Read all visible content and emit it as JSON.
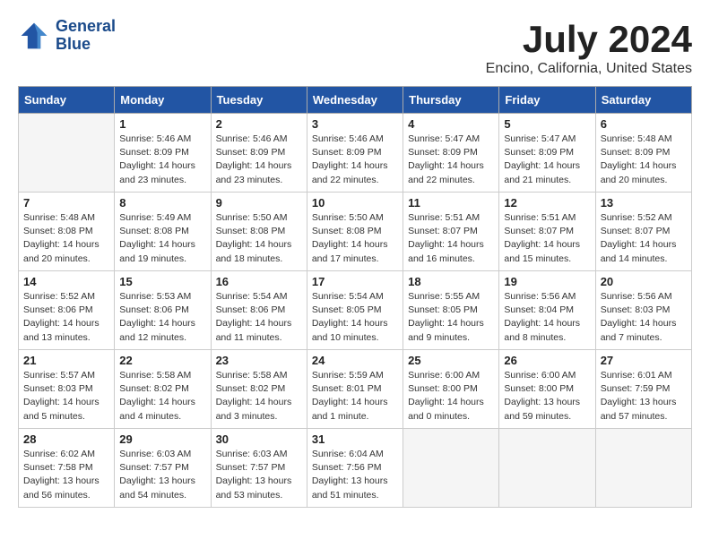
{
  "header": {
    "logo_line1": "General",
    "logo_line2": "Blue",
    "month_title": "July 2024",
    "location": "Encino, California, United States"
  },
  "weekdays": [
    "Sunday",
    "Monday",
    "Tuesday",
    "Wednesday",
    "Thursday",
    "Friday",
    "Saturday"
  ],
  "weeks": [
    [
      {
        "day": "",
        "info": ""
      },
      {
        "day": "1",
        "info": "Sunrise: 5:46 AM\nSunset: 8:09 PM\nDaylight: 14 hours\nand 23 minutes."
      },
      {
        "day": "2",
        "info": "Sunrise: 5:46 AM\nSunset: 8:09 PM\nDaylight: 14 hours\nand 23 minutes."
      },
      {
        "day": "3",
        "info": "Sunrise: 5:46 AM\nSunset: 8:09 PM\nDaylight: 14 hours\nand 22 minutes."
      },
      {
        "day": "4",
        "info": "Sunrise: 5:47 AM\nSunset: 8:09 PM\nDaylight: 14 hours\nand 22 minutes."
      },
      {
        "day": "5",
        "info": "Sunrise: 5:47 AM\nSunset: 8:09 PM\nDaylight: 14 hours\nand 21 minutes."
      },
      {
        "day": "6",
        "info": "Sunrise: 5:48 AM\nSunset: 8:09 PM\nDaylight: 14 hours\nand 20 minutes."
      }
    ],
    [
      {
        "day": "7",
        "info": "Sunrise: 5:48 AM\nSunset: 8:08 PM\nDaylight: 14 hours\nand 20 minutes."
      },
      {
        "day": "8",
        "info": "Sunrise: 5:49 AM\nSunset: 8:08 PM\nDaylight: 14 hours\nand 19 minutes."
      },
      {
        "day": "9",
        "info": "Sunrise: 5:50 AM\nSunset: 8:08 PM\nDaylight: 14 hours\nand 18 minutes."
      },
      {
        "day": "10",
        "info": "Sunrise: 5:50 AM\nSunset: 8:08 PM\nDaylight: 14 hours\nand 17 minutes."
      },
      {
        "day": "11",
        "info": "Sunrise: 5:51 AM\nSunset: 8:07 PM\nDaylight: 14 hours\nand 16 minutes."
      },
      {
        "day": "12",
        "info": "Sunrise: 5:51 AM\nSunset: 8:07 PM\nDaylight: 14 hours\nand 15 minutes."
      },
      {
        "day": "13",
        "info": "Sunrise: 5:52 AM\nSunset: 8:07 PM\nDaylight: 14 hours\nand 14 minutes."
      }
    ],
    [
      {
        "day": "14",
        "info": "Sunrise: 5:52 AM\nSunset: 8:06 PM\nDaylight: 14 hours\nand 13 minutes."
      },
      {
        "day": "15",
        "info": "Sunrise: 5:53 AM\nSunset: 8:06 PM\nDaylight: 14 hours\nand 12 minutes."
      },
      {
        "day": "16",
        "info": "Sunrise: 5:54 AM\nSunset: 8:06 PM\nDaylight: 14 hours\nand 11 minutes."
      },
      {
        "day": "17",
        "info": "Sunrise: 5:54 AM\nSunset: 8:05 PM\nDaylight: 14 hours\nand 10 minutes."
      },
      {
        "day": "18",
        "info": "Sunrise: 5:55 AM\nSunset: 8:05 PM\nDaylight: 14 hours\nand 9 minutes."
      },
      {
        "day": "19",
        "info": "Sunrise: 5:56 AM\nSunset: 8:04 PM\nDaylight: 14 hours\nand 8 minutes."
      },
      {
        "day": "20",
        "info": "Sunrise: 5:56 AM\nSunset: 8:03 PM\nDaylight: 14 hours\nand 7 minutes."
      }
    ],
    [
      {
        "day": "21",
        "info": "Sunrise: 5:57 AM\nSunset: 8:03 PM\nDaylight: 14 hours\nand 5 minutes."
      },
      {
        "day": "22",
        "info": "Sunrise: 5:58 AM\nSunset: 8:02 PM\nDaylight: 14 hours\nand 4 minutes."
      },
      {
        "day": "23",
        "info": "Sunrise: 5:58 AM\nSunset: 8:02 PM\nDaylight: 14 hours\nand 3 minutes."
      },
      {
        "day": "24",
        "info": "Sunrise: 5:59 AM\nSunset: 8:01 PM\nDaylight: 14 hours\nand 1 minute."
      },
      {
        "day": "25",
        "info": "Sunrise: 6:00 AM\nSunset: 8:00 PM\nDaylight: 14 hours\nand 0 minutes."
      },
      {
        "day": "26",
        "info": "Sunrise: 6:00 AM\nSunset: 8:00 PM\nDaylight: 13 hours\nand 59 minutes."
      },
      {
        "day": "27",
        "info": "Sunrise: 6:01 AM\nSunset: 7:59 PM\nDaylight: 13 hours\nand 57 minutes."
      }
    ],
    [
      {
        "day": "28",
        "info": "Sunrise: 6:02 AM\nSunset: 7:58 PM\nDaylight: 13 hours\nand 56 minutes."
      },
      {
        "day": "29",
        "info": "Sunrise: 6:03 AM\nSunset: 7:57 PM\nDaylight: 13 hours\nand 54 minutes."
      },
      {
        "day": "30",
        "info": "Sunrise: 6:03 AM\nSunset: 7:57 PM\nDaylight: 13 hours\nand 53 minutes."
      },
      {
        "day": "31",
        "info": "Sunrise: 6:04 AM\nSunset: 7:56 PM\nDaylight: 13 hours\nand 51 minutes."
      },
      {
        "day": "",
        "info": ""
      },
      {
        "day": "",
        "info": ""
      },
      {
        "day": "",
        "info": ""
      }
    ]
  ]
}
